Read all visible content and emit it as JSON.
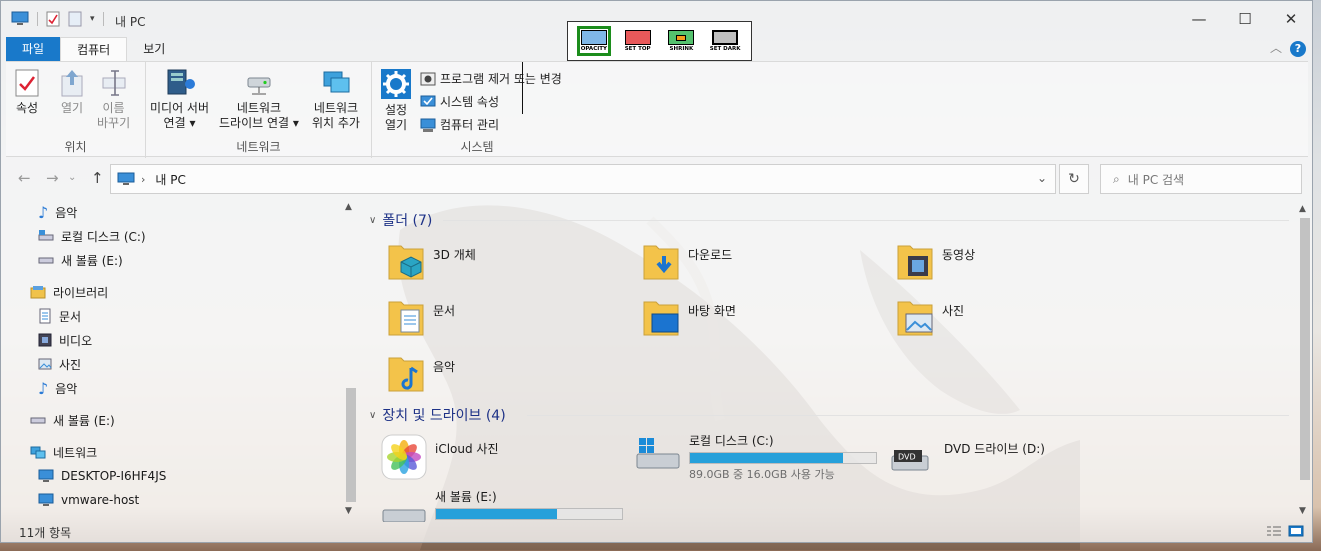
{
  "window": {
    "title": "내 PC"
  },
  "tabs": {
    "file": "파일",
    "computer": "컴퓨터",
    "view": "보기"
  },
  "help": "?",
  "ribbon": {
    "location": {
      "label": "위치",
      "properties": "속성",
      "open": "열기",
      "rename_1": "이름",
      "rename_2": "바꾸기"
    },
    "network": {
      "label": "네트워크",
      "media_1": "미디어 서버",
      "media_2": "연결",
      "map_1": "네트워크",
      "map_2": "드라이브 연결",
      "add_1": "네트워크",
      "add_2": "위치 추가"
    },
    "system": {
      "label": "시스템",
      "settings_1": "설정",
      "settings_2": "열기",
      "uninstall": "프로그램 제거 또는 변경",
      "sysprops": "시스템 속성",
      "manage": "컴퓨터 관리"
    }
  },
  "floating_toolbar": [
    {
      "label": "OPACITY",
      "color": "#7fb7e8",
      "selected": true
    },
    {
      "label": "SET TOP",
      "color": "#e8595a",
      "selected": false
    },
    {
      "label": "SHRINK",
      "color": "#55c26e",
      "selected": false
    },
    {
      "label": "SET DARK",
      "color": "#bfbfbf",
      "selected": false
    }
  ],
  "address": {
    "location": "내 PC",
    "search_placeholder": "내 PC 검색"
  },
  "sidebar": {
    "items": [
      {
        "label": "음악",
        "icon": "music-icon"
      },
      {
        "label": "로컬 디스크 (C:)",
        "icon": "disk-icon"
      },
      {
        "label": "새 볼륨 (E:)",
        "icon": "drive-icon"
      },
      {
        "label": "라이브러리",
        "icon": "library-icon"
      },
      {
        "label": "문서",
        "icon": "document-icon"
      },
      {
        "label": "비디오",
        "icon": "video-icon"
      },
      {
        "label": "사진",
        "icon": "picture-icon"
      },
      {
        "label": "음악",
        "icon": "music-icon"
      },
      {
        "label": "새 볼륨 (E:)",
        "icon": "drive-icon"
      },
      {
        "label": "네트워크",
        "icon": "network-icon"
      },
      {
        "label": "DESKTOP-I6HF4JS",
        "icon": "computer-icon"
      },
      {
        "label": "vmware-host",
        "icon": "computer-icon"
      }
    ]
  },
  "main": {
    "folders_header": "폴더 (7)",
    "folders": [
      {
        "label": "3D 개체"
      },
      {
        "label": "다운로드"
      },
      {
        "label": "동영상"
      },
      {
        "label": "문서"
      },
      {
        "label": "바탕 화면"
      },
      {
        "label": "사진"
      },
      {
        "label": "음악"
      }
    ],
    "drives_header": "장치 및 드라이브 (4)",
    "drives": [
      {
        "label": "iCloud 사진"
      },
      {
        "label": "로컬 디스크 (C:)",
        "free_text": "89.0GB 중 16.0GB 사용 가능",
        "used_fraction": 0.82
      },
      {
        "label": "DVD 드라이브 (D:)"
      },
      {
        "label": "새 볼륨 (E:)",
        "used_fraction": 0.65
      }
    ]
  },
  "status": {
    "items": "11개 항목"
  }
}
